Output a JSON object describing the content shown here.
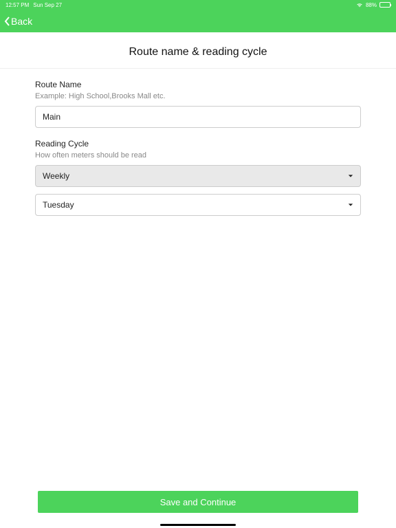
{
  "status": {
    "time": "12:57 PM",
    "date": "Sun Sep 27",
    "battery_pct": "88%"
  },
  "nav": {
    "back_label": "Back"
  },
  "page": {
    "title": "Route name & reading cycle"
  },
  "form": {
    "route_name": {
      "label": "Route Name",
      "hint": "Example: High School,Brooks Mall etc.",
      "value": "Main"
    },
    "reading_cycle": {
      "label": "Reading Cycle",
      "hint": "How often meters should be read",
      "frequency_value": "Weekly",
      "day_value": "Tuesday"
    }
  },
  "actions": {
    "save_label": "Save and Continue"
  }
}
